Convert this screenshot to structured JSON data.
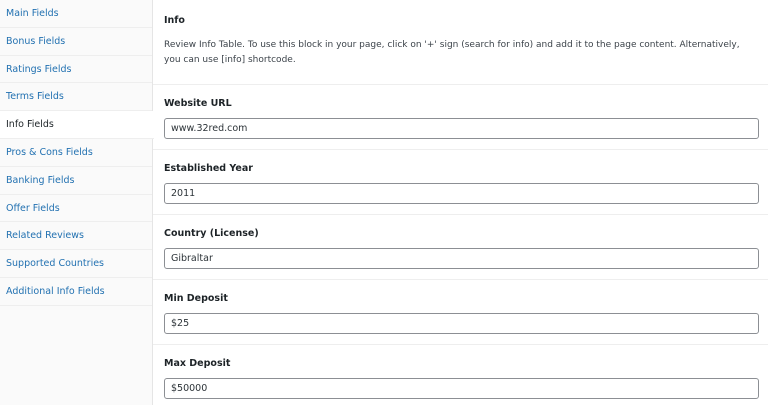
{
  "sidebar": {
    "items": [
      {
        "label": "Main Fields",
        "active": false
      },
      {
        "label": "Bonus Fields",
        "active": false
      },
      {
        "label": "Ratings Fields",
        "active": false
      },
      {
        "label": "Terms Fields",
        "active": false
      },
      {
        "label": "Info Fields",
        "active": true
      },
      {
        "label": "Pros & Cons Fields",
        "active": false
      },
      {
        "label": "Banking Fields",
        "active": false
      },
      {
        "label": "Offer Fields",
        "active": false
      },
      {
        "label": "Related Reviews",
        "active": false
      },
      {
        "label": "Supported Countries",
        "active": false
      },
      {
        "label": "Additional Info Fields",
        "active": false
      }
    ]
  },
  "main": {
    "title": "Info",
    "description": "Review Info Table. To use this block in your page, click on '+' sign (search for info) and add it to the page content. Alternatively, you can use [info] shortcode.",
    "fields": [
      {
        "label": "Website URL",
        "value": "www.32red.com"
      },
      {
        "label": "Established Year",
        "value": "2011"
      },
      {
        "label": "Country (License)",
        "value": "Gibraltar"
      },
      {
        "label": "Min Deposit",
        "value": "$25"
      },
      {
        "label": "Max Deposit",
        "value": "$50000"
      }
    ]
  },
  "colors": {
    "link": "#2271b1",
    "text": "#1d2327",
    "sidebar_bg": "#fafafa",
    "input_border": "#8c8f94"
  }
}
